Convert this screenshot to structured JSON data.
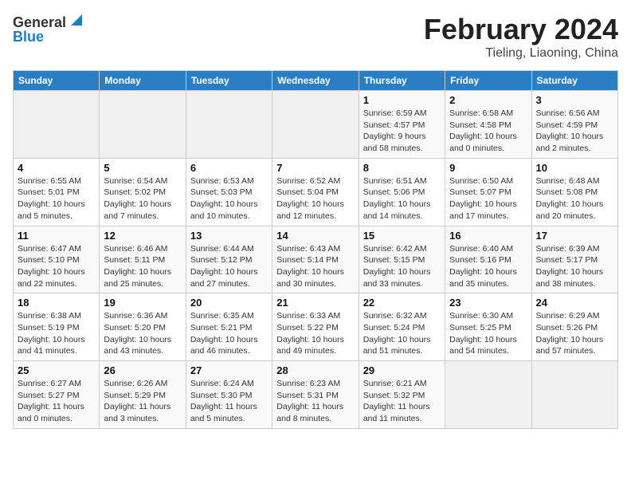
{
  "header": {
    "logo_general": "General",
    "logo_blue": "Blue",
    "month_title": "February 2024",
    "location": "Tieling, Liaoning, China"
  },
  "days_of_week": [
    "Sunday",
    "Monday",
    "Tuesday",
    "Wednesday",
    "Thursday",
    "Friday",
    "Saturday"
  ],
  "weeks": [
    [
      {
        "day": "",
        "info": ""
      },
      {
        "day": "",
        "info": ""
      },
      {
        "day": "",
        "info": ""
      },
      {
        "day": "",
        "info": ""
      },
      {
        "day": "1",
        "info": "Sunrise: 6:59 AM\nSunset: 4:57 PM\nDaylight: 9 hours and 58 minutes."
      },
      {
        "day": "2",
        "info": "Sunrise: 6:58 AM\nSunset: 4:58 PM\nDaylight: 10 hours and 0 minutes."
      },
      {
        "day": "3",
        "info": "Sunrise: 6:56 AM\nSunset: 4:59 PM\nDaylight: 10 hours and 2 minutes."
      }
    ],
    [
      {
        "day": "4",
        "info": "Sunrise: 6:55 AM\nSunset: 5:01 PM\nDaylight: 10 hours and 5 minutes."
      },
      {
        "day": "5",
        "info": "Sunrise: 6:54 AM\nSunset: 5:02 PM\nDaylight: 10 hours and 7 minutes."
      },
      {
        "day": "6",
        "info": "Sunrise: 6:53 AM\nSunset: 5:03 PM\nDaylight: 10 hours and 10 minutes."
      },
      {
        "day": "7",
        "info": "Sunrise: 6:52 AM\nSunset: 5:04 PM\nDaylight: 10 hours and 12 minutes."
      },
      {
        "day": "8",
        "info": "Sunrise: 6:51 AM\nSunset: 5:06 PM\nDaylight: 10 hours and 14 minutes."
      },
      {
        "day": "9",
        "info": "Sunrise: 6:50 AM\nSunset: 5:07 PM\nDaylight: 10 hours and 17 minutes."
      },
      {
        "day": "10",
        "info": "Sunrise: 6:48 AM\nSunset: 5:08 PM\nDaylight: 10 hours and 20 minutes."
      }
    ],
    [
      {
        "day": "11",
        "info": "Sunrise: 6:47 AM\nSunset: 5:10 PM\nDaylight: 10 hours and 22 minutes."
      },
      {
        "day": "12",
        "info": "Sunrise: 6:46 AM\nSunset: 5:11 PM\nDaylight: 10 hours and 25 minutes."
      },
      {
        "day": "13",
        "info": "Sunrise: 6:44 AM\nSunset: 5:12 PM\nDaylight: 10 hours and 27 minutes."
      },
      {
        "day": "14",
        "info": "Sunrise: 6:43 AM\nSunset: 5:14 PM\nDaylight: 10 hours and 30 minutes."
      },
      {
        "day": "15",
        "info": "Sunrise: 6:42 AM\nSunset: 5:15 PM\nDaylight: 10 hours and 33 minutes."
      },
      {
        "day": "16",
        "info": "Sunrise: 6:40 AM\nSunset: 5:16 PM\nDaylight: 10 hours and 35 minutes."
      },
      {
        "day": "17",
        "info": "Sunrise: 6:39 AM\nSunset: 5:17 PM\nDaylight: 10 hours and 38 minutes."
      }
    ],
    [
      {
        "day": "18",
        "info": "Sunrise: 6:38 AM\nSunset: 5:19 PM\nDaylight: 10 hours and 41 minutes."
      },
      {
        "day": "19",
        "info": "Sunrise: 6:36 AM\nSunset: 5:20 PM\nDaylight: 10 hours and 43 minutes."
      },
      {
        "day": "20",
        "info": "Sunrise: 6:35 AM\nSunset: 5:21 PM\nDaylight: 10 hours and 46 minutes."
      },
      {
        "day": "21",
        "info": "Sunrise: 6:33 AM\nSunset: 5:22 PM\nDaylight: 10 hours and 49 minutes."
      },
      {
        "day": "22",
        "info": "Sunrise: 6:32 AM\nSunset: 5:24 PM\nDaylight: 10 hours and 51 minutes."
      },
      {
        "day": "23",
        "info": "Sunrise: 6:30 AM\nSunset: 5:25 PM\nDaylight: 10 hours and 54 minutes."
      },
      {
        "day": "24",
        "info": "Sunrise: 6:29 AM\nSunset: 5:26 PM\nDaylight: 10 hours and 57 minutes."
      }
    ],
    [
      {
        "day": "25",
        "info": "Sunrise: 6:27 AM\nSunset: 5:27 PM\nDaylight: 11 hours and 0 minutes."
      },
      {
        "day": "26",
        "info": "Sunrise: 6:26 AM\nSunset: 5:29 PM\nDaylight: 11 hours and 3 minutes."
      },
      {
        "day": "27",
        "info": "Sunrise: 6:24 AM\nSunset: 5:30 PM\nDaylight: 11 hours and 5 minutes."
      },
      {
        "day": "28",
        "info": "Sunrise: 6:23 AM\nSunset: 5:31 PM\nDaylight: 11 hours and 8 minutes."
      },
      {
        "day": "29",
        "info": "Sunrise: 6:21 AM\nSunset: 5:32 PM\nDaylight: 11 hours and 11 minutes."
      },
      {
        "day": "",
        "info": ""
      },
      {
        "day": "",
        "info": ""
      }
    ]
  ]
}
